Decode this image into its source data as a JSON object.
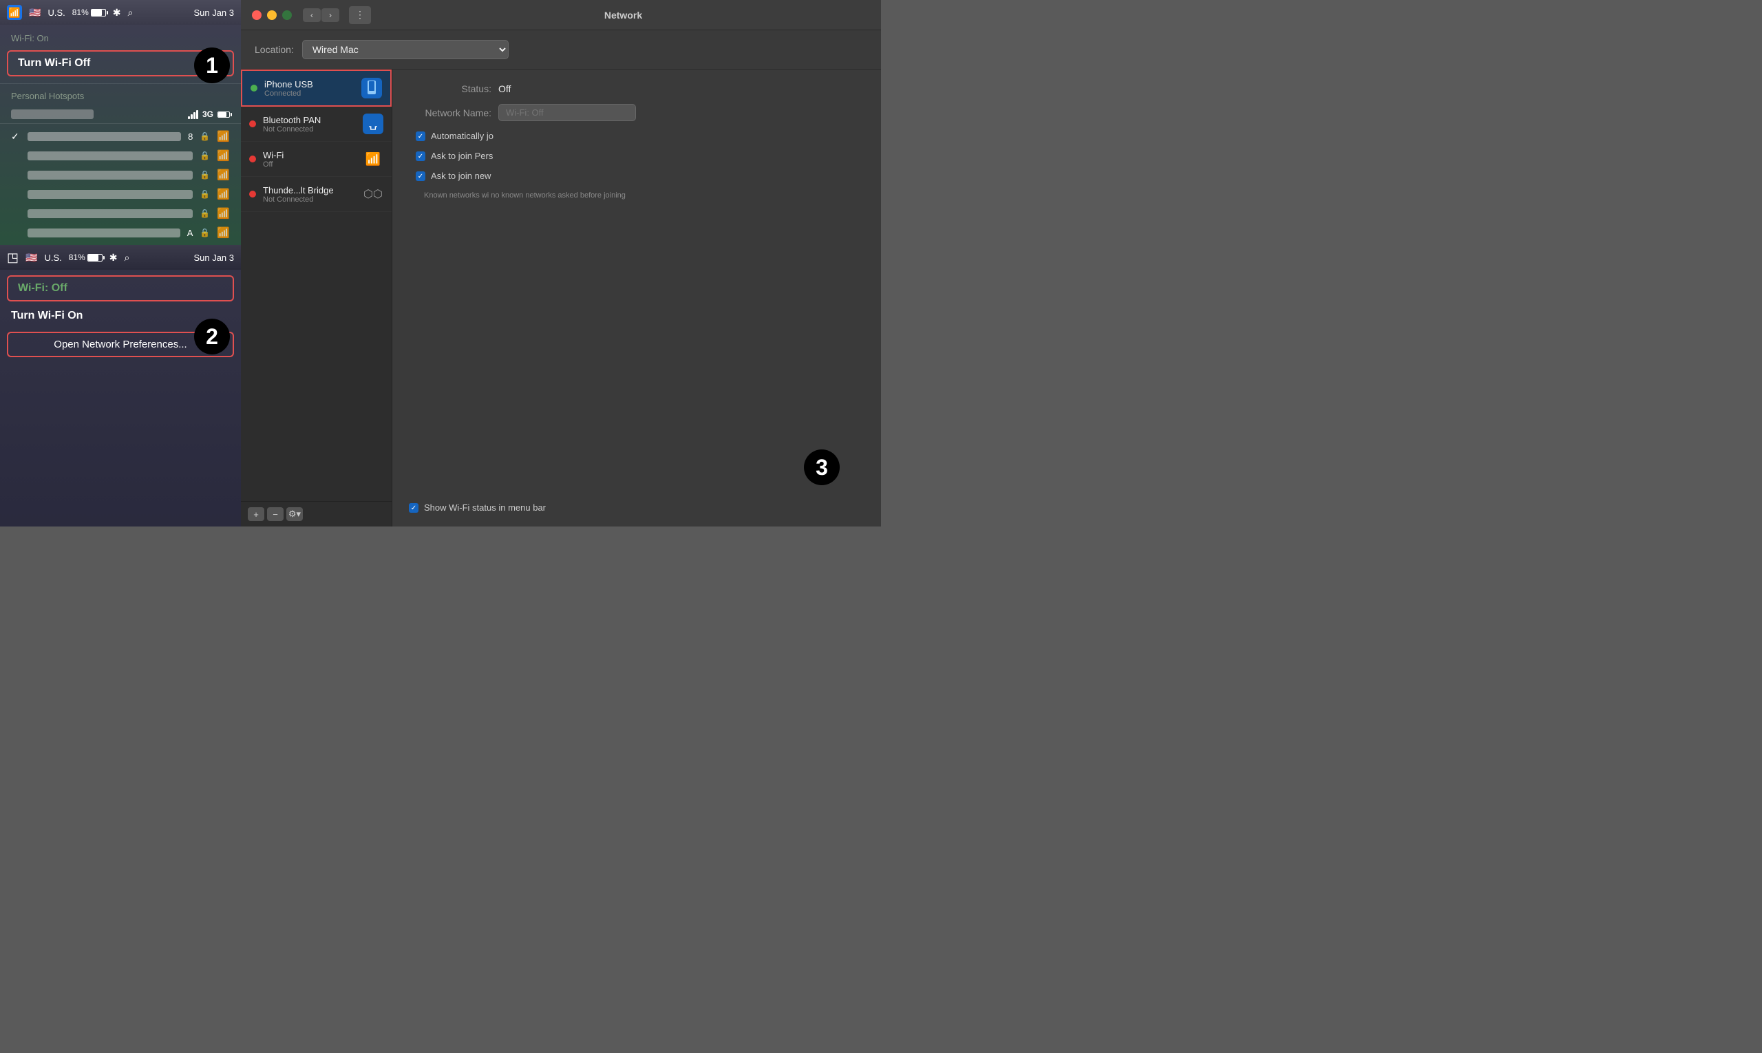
{
  "menubar1": {
    "percent": "81%",
    "time": "Sun Jan 3"
  },
  "menubar2": {
    "percent": "81%",
    "time": "Sun Jan 3"
  },
  "wifi_dropdown_top": {
    "status_label": "Wi-Fi: On",
    "turn_off_label": "Turn Wi-Fi Off",
    "personal_hotspots_label": "Personal Hotspots",
    "badge": "1"
  },
  "wifi_dropdown_bottom": {
    "wifi_off_label": "Wi-Fi: Off",
    "turn_on_label": "Turn Wi-Fi On",
    "open_prefs_label": "Open Network Preferences...",
    "badge": "2"
  },
  "network_window": {
    "title": "Network",
    "location_label": "Location:",
    "location_value": "Wired Mac",
    "networks": [
      {
        "name": "iPhone USB",
        "status": "Connected",
        "dot": "green",
        "icon_type": "iphone",
        "selected": true
      },
      {
        "name": "Bluetooth PAN",
        "status": "Not Connected",
        "dot": "red",
        "icon_type": "bluetooth",
        "selected": false
      },
      {
        "name": "Wi-Fi",
        "status": "Off",
        "dot": "red",
        "icon_type": "wifi",
        "selected": false
      },
      {
        "name": "Thunde...lt Bridge",
        "status": "Not Connected",
        "dot": "red",
        "icon_type": "thunderbolt",
        "selected": false
      }
    ],
    "status_label": "Status:",
    "status_value": "Off",
    "network_name_label": "Network Name:",
    "network_name_placeholder": "Wi-Fi: Off",
    "auto_join_label": "Automatically jo",
    "ask_personal_label": "Ask to join Pers",
    "ask_new_label": "Ask to join new",
    "known_note": "Known networks wi no known networks asked before joining",
    "show_wifi_label": "Show Wi-Fi status in menu bar",
    "badge3": "3"
  }
}
